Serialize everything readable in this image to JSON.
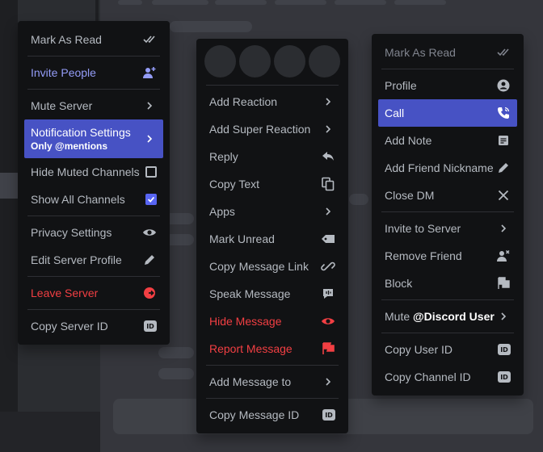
{
  "server_menu": {
    "items": [
      {
        "label": "Mark As Read",
        "icon": "double-check-icon"
      },
      {
        "label": "Invite People",
        "icon": "add-person-icon"
      },
      {
        "label": "Mute Server",
        "icon": "chevron-right-icon"
      },
      {
        "label": "Notification Settings",
        "sublabel": "Only @mentions",
        "icon": "chevron-right-icon"
      },
      {
        "label": "Hide Muted Channels",
        "checked": false
      },
      {
        "label": "Show All Channels",
        "checked": true
      },
      {
        "label": "Privacy Settings",
        "icon": "eye-icon"
      },
      {
        "label": "Edit Server Profile",
        "icon": "pencil-icon"
      },
      {
        "label": "Leave Server",
        "icon": "leave-icon"
      },
      {
        "label": "Copy Server ID",
        "icon": "id-icon"
      }
    ]
  },
  "message_menu": {
    "items": [
      {
        "label": "Add Reaction",
        "icon": "chevron-right-icon"
      },
      {
        "label": "Add Super Reaction",
        "icon": "chevron-right-icon"
      },
      {
        "label": "Reply",
        "icon": "reply-icon"
      },
      {
        "label": "Copy Text",
        "icon": "copy-icon"
      },
      {
        "label": "Apps",
        "icon": "chevron-right-icon"
      },
      {
        "label": "Mark Unread",
        "icon": "mark-unread-icon"
      },
      {
        "label": "Copy Message Link",
        "icon": "link-icon"
      },
      {
        "label": "Speak Message",
        "icon": "speak-icon"
      },
      {
        "label": "Hide Message",
        "icon": "eye-icon"
      },
      {
        "label": "Report Message",
        "icon": "flag-icon"
      },
      {
        "label": "Add Message to",
        "icon": "chevron-right-icon"
      },
      {
        "label": "Copy Message ID",
        "icon": "id-icon"
      }
    ]
  },
  "user_menu": {
    "items": [
      {
        "label": "Mark As Read",
        "icon": "double-check-icon"
      },
      {
        "label": "Profile",
        "icon": "profile-icon"
      },
      {
        "label": "Call",
        "icon": "phone-icon"
      },
      {
        "label": "Add Note",
        "icon": "note-icon"
      },
      {
        "label": "Add Friend Nickname",
        "icon": "pencil-icon"
      },
      {
        "label": "Close DM",
        "icon": "close-icon"
      },
      {
        "label": "Invite to Server",
        "icon": "chevron-right-icon"
      },
      {
        "label": "Remove Friend",
        "icon": "remove-person-icon"
      },
      {
        "label": "Block",
        "icon": "block-icon"
      },
      {
        "label_prefix": "Mute ",
        "label_bold": "@Discord User",
        "icon": "chevron-right-icon"
      },
      {
        "label": "Copy User ID",
        "icon": "id-icon"
      },
      {
        "label": "Copy Channel ID",
        "icon": "id-icon"
      }
    ]
  },
  "badges": {
    "id": "ID"
  },
  "colors": {
    "menu_bg": "#111214",
    "text": "#b5bac1",
    "active": "#4752c4",
    "danger": "#f23f43",
    "blurple_text": "#949cf7",
    "checkbox": "#5865f2"
  }
}
